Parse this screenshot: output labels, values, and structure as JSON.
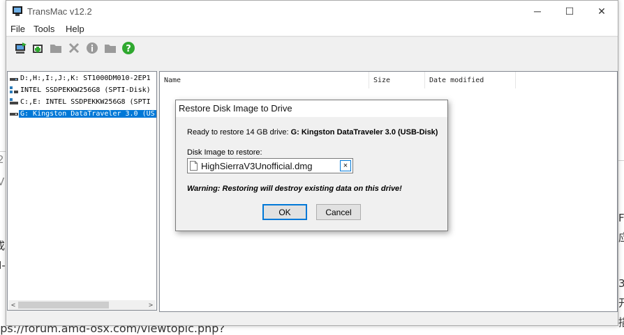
{
  "window": {
    "title": "TransMac v12.2",
    "minimize_glyph": "─",
    "maximize_glyph": "☐",
    "close_glyph": "✕"
  },
  "menu": {
    "items": [
      "File",
      "Tools",
      "Help"
    ]
  },
  "toolbar": {
    "buttons": [
      {
        "icon": "refresh-drives-icon",
        "enabled": true
      },
      {
        "icon": "add-folder-icon",
        "enabled": true
      },
      {
        "icon": "folder-icon",
        "enabled": false
      },
      {
        "icon": "delete-icon",
        "enabled": false
      },
      {
        "icon": "info-icon",
        "enabled": false
      },
      {
        "icon": "folder-open-icon",
        "enabled": false
      },
      {
        "icon": "help-icon",
        "enabled": true
      }
    ]
  },
  "drives": {
    "items": [
      {
        "label": "D:,H:,I:,J:,K:  ST1000DM010-2EP1",
        "icon": "hard-drive-icon",
        "selected": false
      },
      {
        "label": " INTEL SSDPEKKW256G8 (SPTI-Disk)",
        "icon": "partition-icon",
        "selected": false
      },
      {
        "label": "C:,E:  INTEL SSDPEKKW256G8 (SPTI",
        "icon": "hard-drive-icon",
        "selected": false
      },
      {
        "label": "G: Kingston DataTraveler 3.0 (US",
        "icon": "usb-drive-icon",
        "selected": true
      }
    ],
    "scroll_left": "<",
    "scroll_right": ">"
  },
  "file_list": {
    "columns": [
      "Name",
      "Size",
      "Date modified"
    ]
  },
  "dialog": {
    "title": "Restore Disk Image to Drive",
    "ready_prefix": "Ready to restore 14 GB drive: ",
    "ready_drive": "G: Kingston DataTraveler 3.0 (USB-Disk)",
    "image_label": "Disk Image to restore:",
    "image_value": "HighSierraV3Unofficial.dmg",
    "clear_glyph": "×",
    "warning": "Warning: Restoring will destroy existing data on this drive!",
    "ok_label": "OK",
    "cancel_label": "Cancel"
  },
  "background": {
    "url_fragment": "tps://forum.amd-osx.com/viewtopic.php?",
    "right_fragments": [
      "F",
      "应",
      "3",
      "开",
      "描"
    ],
    "left_fragments": [
      "2",
      "V",
      "或",
      "I-"
    ]
  },
  "colors": {
    "selection": "#0078d7",
    "help_green": "#2fa82f"
  }
}
